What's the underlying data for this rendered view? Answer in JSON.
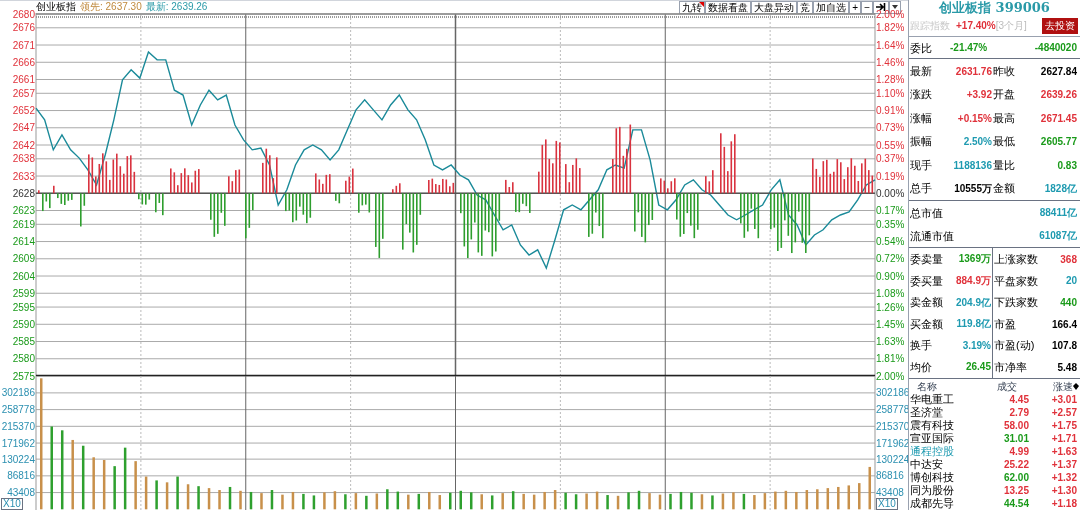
{
  "header": {
    "name": "创业板指",
    "lead": "领先: 2637.30",
    "last": "最新: 2639.26"
  },
  "toolbar": [
    {
      "label": "九转",
      "flagged": true
    },
    {
      "label": "数据看盘",
      "flagged": false
    },
    {
      "label": "大盘异动",
      "flagged": false
    },
    {
      "label": "竞",
      "flagged": false
    },
    {
      "label": "加自选",
      "flagged": false
    },
    {
      "label": "+",
      "flagged": false
    },
    {
      "label": "−",
      "flagged": false
    }
  ],
  "price_chart": {
    "right_axis": [
      "2.00%",
      "1.82%",
      "1.64%",
      "1.46%",
      "1.28%",
      "1.10%",
      "0.91%",
      "0.73%",
      "0.55%",
      "0.37%",
      "0.19%",
      "0.00%",
      "0.17%",
      "0.35%",
      "0.54%",
      "0.72%",
      "0.90%",
      "1.08%",
      "1.26%",
      "1.45%",
      "1.63%",
      "1.81%",
      "2.00%"
    ],
    "chart_data": {
      "type": "line",
      "grid": true,
      "ylim": [
        2575,
        2680
      ],
      "categories": [
        null,
        null,
        null,
        null,
        null,
        null,
        null,
        null,
        null,
        null,
        null,
        null,
        null,
        null,
        null,
        null,
        null,
        null,
        null,
        null,
        null,
        null,
        null,
        null,
        null,
        null,
        null,
        null,
        null,
        null,
        null,
        null,
        null,
        null,
        null,
        null,
        null,
        null,
        null,
        null,
        null,
        null,
        null,
        null,
        null,
        null,
        null,
        null,
        null,
        null,
        null,
        null,
        null,
        null,
        null,
        null,
        null,
        null,
        null,
        null,
        null,
        null,
        null,
        null,
        null,
        null,
        null,
        null,
        null,
        null,
        null,
        null,
        null,
        null,
        null,
        null,
        null,
        null,
        null,
        null,
        null,
        null,
        null,
        null,
        null,
        null,
        null,
        null,
        null,
        null,
        null,
        null,
        null,
        null,
        null,
        null,
        null,
        null
      ],
      "yticks": [
        2680,
        2676,
        2671,
        2666,
        2661,
        2657,
        2652,
        2647,
        2642,
        2638,
        2633,
        2628,
        2623,
        2619,
        2614,
        2609,
        2604,
        2599,
        2595,
        2590,
        2585,
        2580,
        2575
      ],
      "series": [
        {
          "color": "#1a8a99",
          "values": [
            2652.7,
            2649.3,
            2640.6,
            2644.9,
            2640.6,
            2638.2,
            2634.8,
            2630.4,
            2639.1,
            2649.3,
            2660.9,
            2663.8,
            2661.4,
            2669.0,
            2666.7,
            2666.7,
            2657.9,
            2656.5,
            2647.8,
            2653.6,
            2657.9,
            2655.1,
            2656.5,
            2647.8,
            2643.5,
            2640.6,
            2641.1,
            2636.2,
            2624.6,
            2629.0,
            2636.2,
            2640.6,
            2642.0,
            2640.6,
            2637.7,
            2640.6,
            2646.4,
            2652.2,
            2655.1,
            2652.2,
            2649.3,
            2653.6,
            2656.5,
            2652.2,
            2649.3,
            2643.5,
            2636.2,
            2634.8,
            2636.2,
            2633.3,
            2631.9,
            2627.5,
            2626.1,
            2621.7,
            2617.4,
            2618.8,
            2613.0,
            2610.1,
            2611.6,
            2606.3,
            2614.5,
            2623.2,
            2624.6,
            2623.2,
            2626.1,
            2629.0,
            2634.8,
            2636.2,
            2635.3,
            2646.4,
            2646.4,
            2637.7,
            2624.6,
            2623.2,
            2626.1,
            2630.4,
            2631.9,
            2629.0,
            2627.5,
            2624.6,
            2621.7,
            2620.3,
            2621.7,
            2623.2,
            2624.6,
            2629.0,
            2631.9,
            2621.7,
            2618.8,
            2613.0,
            2615.9,
            2617.4,
            2620.3,
            2621.7,
            2622.6,
            2626.1,
            2630.4,
            2631.9
          ]
        }
      ]
    }
  },
  "volume_chart": {
    "right_axis": [
      "302186",
      "258778",
      "215370",
      "171962",
      "130224",
      "86816",
      "43408"
    ],
    "multiplier_left": "X10",
    "multiplier_right": "X10",
    "bars": [
      {
        "color": "#c8904a"
      },
      {
        "color": "#2ea02e"
      },
      {
        "color": "#2ea02e"
      },
      {
        "color": "#c8904a"
      },
      {
        "color": "#2ea02e"
      },
      {
        "color": "#c8904a"
      },
      {
        "color": "#c8904a"
      },
      {
        "color": "#2ea02e"
      },
      {
        "color": "#2ea02e"
      },
      {
        "color": "#c8904a"
      },
      {
        "color": "#c8904a"
      },
      {
        "color": "#2ea02e"
      },
      {
        "color": "#c8904a"
      },
      {
        "color": "#2ea02e"
      },
      {
        "color": "#c8904a"
      },
      {
        "color": "#2ea02e"
      },
      {
        "color": "#c8904a"
      },
      {
        "color": "#c8904a"
      },
      {
        "color": "#2ea02e"
      },
      {
        "color": "#c8904a"
      },
      {
        "color": "#2ea02e"
      },
      {
        "color": "#c8904a"
      },
      {
        "color": "#2ea02e"
      },
      {
        "color": "#c8904a"
      },
      {
        "color": "#c8904a"
      },
      {
        "color": "#2ea02e"
      },
      {
        "color": "#2ea02e"
      },
      {
        "color": "#c8904a"
      },
      {
        "color": "#c8904a"
      },
      {
        "color": "#2ea02e"
      },
      {
        "color": "#c8904a"
      },
      {
        "color": "#2ea02e"
      },
      {
        "color": "#c8904a"
      },
      {
        "color": "#2ea02e"
      },
      {
        "color": "#2ea02e"
      },
      {
        "color": "#c8904a"
      },
      {
        "color": "#2ea02e"
      },
      {
        "color": "#c8904a"
      },
      {
        "color": "#c8904a"
      },
      {
        "color": "#2ea02e"
      },
      {
        "color": "#2ea02e"
      },
      {
        "color": "#2ea02e"
      },
      {
        "color": "#c8904a"
      },
      {
        "color": "#2ea02e"
      },
      {
        "color": "#c8904a"
      },
      {
        "color": "#2ea02e"
      },
      {
        "color": "#c8904a"
      },
      {
        "color": "#c8904a"
      },
      {
        "color": "#c8904a"
      },
      {
        "color": "#c8904a"
      },
      {
        "color": "#2ea02e"
      },
      {
        "color": "#2ea02e"
      },
      {
        "color": "#c8904a"
      },
      {
        "color": "#c8904a"
      },
      {
        "color": "#2ea02e"
      },
      {
        "color": "#c8904a"
      },
      {
        "color": "#2ea02e"
      },
      {
        "color": "#2ea02e"
      },
      {
        "color": "#c8904a"
      },
      {
        "color": "#c8904a"
      },
      {
        "color": "#2ea02e"
      },
      {
        "color": "#2ea02e"
      },
      {
        "color": "#2ea02e"
      },
      {
        "color": "#c8904a"
      },
      {
        "color": "#2ea02e"
      },
      {
        "color": "#c8904a"
      },
      {
        "color": "#c8904a"
      },
      {
        "color": "#2ea02e"
      },
      {
        "color": "#c8904a"
      },
      {
        "color": "#c8904a"
      },
      {
        "color": "#c8904a"
      },
      {
        "color": "#c8904a"
      },
      {
        "color": "#c8904a"
      },
      {
        "color": "#c8904a"
      },
      {
        "color": "#c8904a"
      },
      {
        "color": "#c8904a"
      },
      {
        "color": "#c8904a"
      },
      {
        "color": "#c8904a"
      },
      {
        "color": "#c8904a"
      },
      {
        "color": "#c8904a"
      }
    ],
    "chart_data": {
      "type": "bar",
      "grid": true,
      "ylim": [
        0,
        346000
      ],
      "yticks": [
        302186,
        258778,
        215370,
        171962,
        130224,
        86816,
        43408
      ],
      "categories": [
        null,
        null,
        null,
        null,
        null,
        null,
        null,
        null,
        null,
        null,
        null,
        null,
        null,
        null,
        null,
        null,
        null,
        null,
        null,
        null,
        null,
        null,
        null,
        null,
        null,
        null,
        null,
        null,
        null,
        null,
        null,
        null,
        null,
        null,
        null,
        null,
        null,
        null,
        null,
        null,
        null,
        null,
        null,
        null,
        null,
        null,
        null,
        null,
        null,
        null,
        null,
        null,
        null,
        null,
        null,
        null,
        null,
        null,
        null,
        null,
        null,
        null,
        null,
        null,
        null,
        null,
        null,
        null,
        null,
        null,
        null,
        null,
        null,
        null,
        null,
        null,
        null,
        null,
        null,
        null
      ],
      "values": [
        340000,
        215000,
        205000,
        180000,
        165000,
        135000,
        128000,
        112000,
        160000,
        125000,
        85000,
        75000,
        70000,
        85000,
        65000,
        60000,
        55000,
        50000,
        58000,
        48000,
        45000,
        42000,
        50000,
        38000,
        45000,
        40000,
        36000,
        44000,
        47000,
        39000,
        42000,
        35000,
        41000,
        52000,
        46000,
        38000,
        40000,
        45000,
        37000,
        43000,
        48000,
        44000,
        39000,
        36000,
        42000,
        47000,
        40000,
        38000,
        45000,
        50000,
        43000,
        39000,
        41000,
        46000,
        37000,
        35000,
        44000,
        48000,
        42000,
        38000,
        40000,
        45000,
        43000,
        39000,
        36000,
        41000,
        44000,
        40000,
        37000,
        42000,
        46000,
        48000,
        45000,
        50000,
        52000,
        55000,
        58000,
        62000,
        68000,
        110000
      ]
    }
  },
  "panel": {
    "title": "创业板指 399006",
    "tracking": {
      "label": "跟踪指数",
      "change": "+17.40%",
      "period": "[3个月]",
      "button": "去投资"
    },
    "ratio": {
      "label": "委比",
      "percent": "-21.47%",
      "value": "-4840020",
      "color": "#1a9a1a"
    },
    "quote_rows": [
      {
        "cells": [
          {
            "label": "最新",
            "value": "2631.76",
            "color": "#e0313a"
          },
          {
            "label": "昨收",
            "value": "2627.84",
            "color": "#000000"
          }
        ]
      },
      {
        "cells": [
          {
            "label": "涨跌",
            "value": "+3.92",
            "color": "#e0313a"
          },
          {
            "label": "开盘",
            "value": "2639.26",
            "color": "#e0313a"
          }
        ]
      },
      {
        "cells": [
          {
            "label": "涨幅",
            "value": "+0.15%",
            "color": "#e0313a"
          },
          {
            "label": "最高",
            "value": "2671.45",
            "color": "#e0313a"
          }
        ]
      },
      {
        "cells": [
          {
            "label": "振幅",
            "value": "2.50%",
            "color": "#1e9ab0"
          },
          {
            "label": "最低",
            "value": "2605.77",
            "color": "#1a9a1a"
          }
        ]
      },
      {
        "cells": [
          {
            "label": "现手",
            "value": "1188136",
            "color": "#1e9ab0"
          },
          {
            "label": "量比",
            "value": "0.83",
            "color": "#1a9a1a"
          }
        ]
      },
      {
        "cells": [
          {
            "label": "总手",
            "value": "10555万",
            "color": "#000000"
          },
          {
            "label": "金额",
            "value": "1828亿",
            "color": "#1e9ab0"
          }
        ]
      }
    ],
    "market_cap": [
      {
        "label": "总市值",
        "value": "88411亿",
        "color": "#1e9ab0"
      },
      {
        "label": "流通市值",
        "value": "61087亿",
        "color": "#1e9ab0"
      }
    ],
    "stats": [
      {
        "cells": [
          {
            "label": "委卖量",
            "value": "1369万",
            "color": "#1a9a1a"
          },
          {
            "label": "上涨家数",
            "value": "368",
            "color": "#e0313a"
          }
        ]
      },
      {
        "cells": [
          {
            "label": "委买量",
            "value": "884.9万",
            "color": "#e0313a"
          },
          {
            "label": "平盘家数",
            "value": "20",
            "color": "#1e9ab0"
          }
        ]
      },
      {
        "cells": [
          {
            "label": "卖金额",
            "value": "204.9亿",
            "color": "#1e9ab0"
          },
          {
            "label": "下跌家数",
            "value": "440",
            "color": "#1a9a1a"
          }
        ]
      },
      {
        "cells": [
          {
            "label": "买金额",
            "value": "119.8亿",
            "color": "#1e9ab0"
          },
          {
            "label": "市盈",
            "value": "166.4",
            "color": "#000000"
          }
        ]
      },
      {
        "cells": [
          {
            "label": "换手",
            "value": "3.19%",
            "color": "#1e9ab0"
          },
          {
            "label": "市盈(动)",
            "value": "107.8",
            "color": "#000000"
          }
        ]
      },
      {
        "cells": [
          {
            "label": "均价",
            "value": "26.45",
            "color": "#1a9a1a"
          },
          {
            "label": "市净率",
            "value": "5.48",
            "color": "#000000"
          }
        ]
      }
    ],
    "stock_columns": [
      "名称",
      "成交",
      "涨速"
    ],
    "stocks": [
      {
        "name": "华电重工",
        "highlighted": false,
        "price": "4.45",
        "color": "#e0313a",
        "speed": "+3.01"
      },
      {
        "name": "圣济堂",
        "highlighted": false,
        "price": "2.79",
        "color": "#e0313a",
        "speed": "+2.57"
      },
      {
        "name": "震有科技",
        "highlighted": false,
        "price": "58.00",
        "color": "#e0313a",
        "speed": "+1.75"
      },
      {
        "name": "宣亚国际",
        "highlighted": false,
        "price": "31.01",
        "color": "#1a9a1a",
        "speed": "+1.71"
      },
      {
        "name": "通程控股",
        "highlighted": true,
        "price": "4.99",
        "color": "#e0313a",
        "speed": "+1.63"
      },
      {
        "name": "中达安",
        "highlighted": false,
        "price": "25.22",
        "color": "#e0313a",
        "speed": "+1.37"
      },
      {
        "name": "博创科技",
        "highlighted": false,
        "price": "62.00",
        "color": "#1a9a1a",
        "speed": "+1.32"
      },
      {
        "name": "同为股份",
        "highlighted": false,
        "price": "13.25",
        "color": "#e0313a",
        "speed": "+1.30"
      },
      {
        "name": "成都先导",
        "highlighted": false,
        "price": "44.54",
        "color": "#1a9a1a",
        "speed": "+1.18"
      }
    ]
  }
}
